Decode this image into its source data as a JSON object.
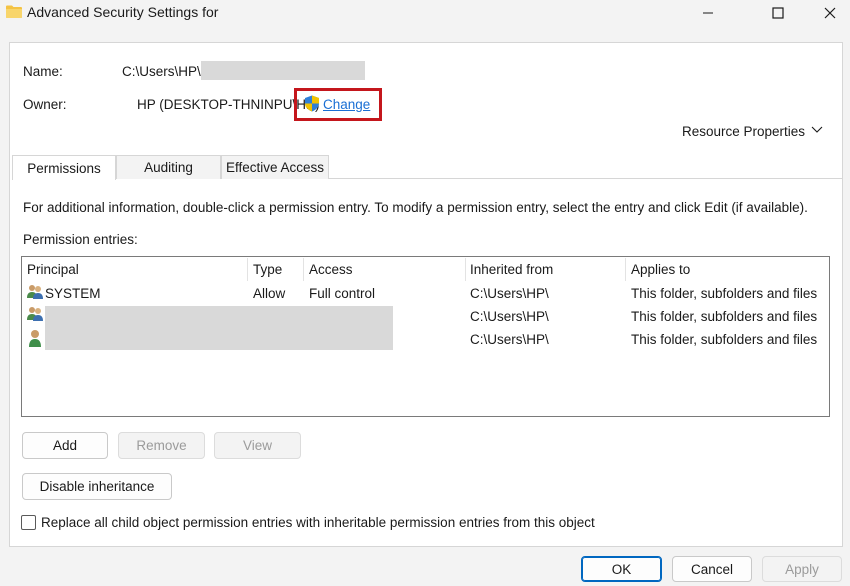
{
  "window": {
    "title": "Advanced Security Settings for",
    "minimize_icon": "minimize-icon",
    "maximize_icon": "maximize-icon",
    "close_icon": "close-icon"
  },
  "info": {
    "name_label": "Name:",
    "name_value": "C:\\Users\\HP\\",
    "owner_label": "Owner:",
    "owner_value": "HP (DESKTOP-THNINPU\\HP)",
    "change_link": "Change",
    "resource_properties": "Resource Properties"
  },
  "tabs": [
    {
      "label": "Permissions",
      "active": true
    },
    {
      "label": "Auditing",
      "active": false
    },
    {
      "label": "Effective Access",
      "active": false
    }
  ],
  "permissions": {
    "instructions": "For additional information, double-click a permission entry. To modify a permission entry, select the entry and click Edit (if available).",
    "entries_label": "Permission entries:",
    "columns": [
      "Principal",
      "Type",
      "Access",
      "Inherited from",
      "Applies to"
    ],
    "rows": [
      {
        "principal": "SYSTEM",
        "type": "Allow",
        "access": "Full control",
        "inherited": "C:\\Users\\HP\\",
        "applies": "This folder, subfolders and files",
        "icon": "group-users-icon"
      },
      {
        "principal": "",
        "type": "",
        "access": "",
        "inherited": "C:\\Users\\HP\\",
        "applies": "This folder, subfolders and files",
        "icon": "group-users-icon"
      },
      {
        "principal": "",
        "type": "",
        "access": "",
        "inherited": "C:\\Users\\HP\\",
        "applies": "This folder, subfolders and files",
        "icon": "user-icon"
      }
    ]
  },
  "buttons": {
    "add": "Add",
    "remove": "Remove",
    "view": "View",
    "disable_inheritance": "Disable inheritance",
    "ok": "OK",
    "cancel": "Cancel",
    "apply": "Apply"
  },
  "replace_checkbox": {
    "label": "Replace all child object permission entries with inheritable permission entries from this object",
    "checked": false
  },
  "colors": {
    "highlight_border": "#c4161c",
    "link": "#1a6fd4",
    "primary_button_border": "#0067c0"
  }
}
